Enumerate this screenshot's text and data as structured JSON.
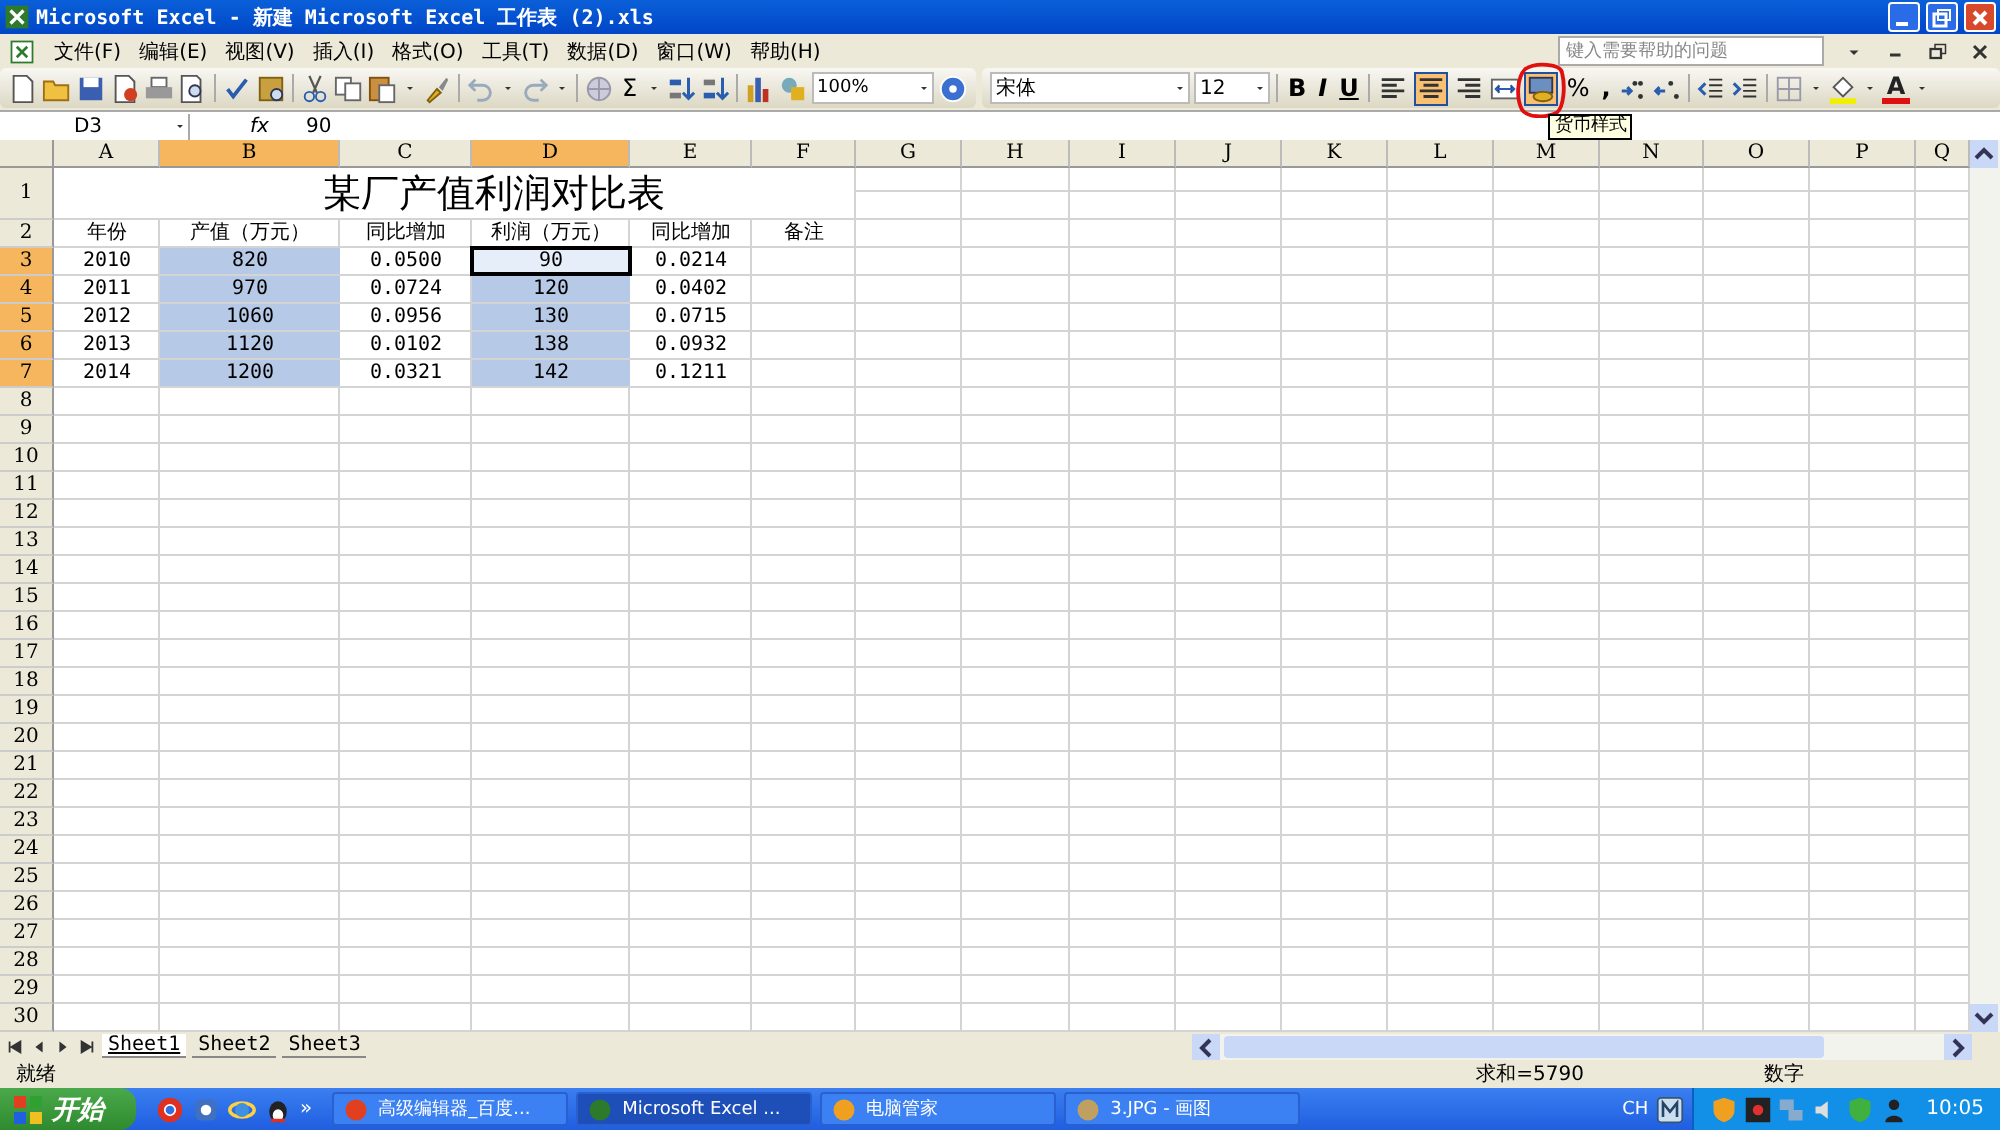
{
  "window": {
    "title": "Microsoft Excel - 新建 Microsoft Excel 工作表 (2).xls"
  },
  "menu": [
    "文件(F)",
    "编辑(E)",
    "视图(V)",
    "插入(I)",
    "格式(O)",
    "工具(T)",
    "数据(D)",
    "窗口(W)",
    "帮助(H)"
  ],
  "help_box": {
    "placeholder": "键入需要帮助的问题"
  },
  "toolbar": {
    "sum": "Σ",
    "zoom": "100%",
    "font": "宋体",
    "size": "12",
    "bold": "B",
    "italic": "I",
    "underline": "U",
    "alignment": [
      {
        "selected": false
      },
      {
        "selected": true
      },
      {
        "selected": false
      }
    ],
    "currency": {
      "pressed": true,
      "tooltip": "货币样式"
    },
    "percent": "%",
    "comma": ",",
    "font_color": "A"
  },
  "formula_bar": {
    "name_box": "D3",
    "fx": "fx",
    "value": "90"
  },
  "columns": [
    {
      "label": "A",
      "selected": false
    },
    {
      "label": "B",
      "selected": true
    },
    {
      "label": "C",
      "selected": false
    },
    {
      "label": "D",
      "selected": true
    },
    {
      "label": "E",
      "selected": false
    },
    {
      "label": "F",
      "selected": false
    },
    {
      "label": "G",
      "selected": false
    },
    {
      "label": "H",
      "selected": false
    },
    {
      "label": "I",
      "selected": false
    },
    {
      "label": "J",
      "selected": false
    },
    {
      "label": "K",
      "selected": false
    },
    {
      "label": "L",
      "selected": false
    },
    {
      "label": "M",
      "selected": false
    },
    {
      "label": "N",
      "selected": false
    },
    {
      "label": "O",
      "selected": false
    },
    {
      "label": "P",
      "selected": false
    },
    {
      "label": "Q",
      "selected": false
    }
  ],
  "rows": [
    {
      "number": "1",
      "selected": false,
      "title": "某厂产值利润对比表"
    },
    {
      "number": "2",
      "selected": false,
      "cells": [
        {
          "text": "年份",
          "selected": false,
          "active": false
        },
        {
          "text": "产值（万元）",
          "selected": false,
          "active": false
        },
        {
          "text": "同比增加",
          "selected": false,
          "active": false
        },
        {
          "text": "利润（万元）",
          "selected": false,
          "active": false
        },
        {
          "text": "同比增加",
          "selected": false,
          "active": false
        },
        {
          "text": "备注",
          "selected": false,
          "active": false
        }
      ]
    },
    {
      "number": "3",
      "selected": true,
      "cells": [
        {
          "text": "2010",
          "selected": false,
          "active": false
        },
        {
          "text": "820",
          "selected": true,
          "active": false
        },
        {
          "text": "0.0500",
          "selected": false,
          "active": false
        },
        {
          "text": "90",
          "selected": true,
          "active": true
        },
        {
          "text": "0.0214",
          "selected": false,
          "active": false
        }
      ]
    },
    {
      "number": "4",
      "selected": true,
      "cells": [
        {
          "text": "2011",
          "selected": false,
          "active": false
        },
        {
          "text": "970",
          "selected": true,
          "active": false
        },
        {
          "text": "0.0724",
          "selected": false,
          "active": false
        },
        {
          "text": "120",
          "selected": true,
          "active": false
        },
        {
          "text": "0.0402",
          "selected": false,
          "active": false
        }
      ]
    },
    {
      "number": "5",
      "selected": true,
      "cells": [
        {
          "text": "2012",
          "selected": false,
          "active": false
        },
        {
          "text": "1060",
          "selected": true,
          "active": false
        },
        {
          "text": "0.0956",
          "selected": false,
          "active": false
        },
        {
          "text": "130",
          "selected": true,
          "active": false
        },
        {
          "text": "0.0715",
          "selected": false,
          "active": false
        }
      ]
    },
    {
      "number": "6",
      "selected": true,
      "cells": [
        {
          "text": "2013",
          "selected": false,
          "active": false
        },
        {
          "text": "1120",
          "selected": true,
          "active": false
        },
        {
          "text": "0.0102",
          "selected": false,
          "active": false
        },
        {
          "text": "138",
          "selected": true,
          "active": false
        },
        {
          "text": "0.0932",
          "selected": false,
          "active": false
        }
      ]
    },
    {
      "number": "7",
      "selected": true,
      "cells": [
        {
          "text": "2014",
          "selected": false,
          "active": false
        },
        {
          "text": "1200",
          "selected": true,
          "active": false
        },
        {
          "text": "0.0321",
          "selected": false,
          "active": false
        },
        {
          "text": "142",
          "selected": true,
          "active": false
        },
        {
          "text": "0.1211",
          "selected": false,
          "active": false
        }
      ]
    },
    {
      "number": "8",
      "selected": false
    },
    {
      "number": "9",
      "selected": false
    },
    {
      "number": "10",
      "selected": false
    },
    {
      "number": "11",
      "selected": false
    },
    {
      "number": "12",
      "selected": false
    },
    {
      "number": "13",
      "selected": false
    },
    {
      "number": "14",
      "selected": false
    },
    {
      "number": "15",
      "selected": false
    },
    {
      "number": "16",
      "selected": false
    },
    {
      "number": "17",
      "selected": false
    },
    {
      "number": "18",
      "selected": false
    },
    {
      "number": "19",
      "selected": false
    },
    {
      "number": "20",
      "selected": false
    },
    {
      "number": "21",
      "selected": false
    },
    {
      "number": "22",
      "selected": false
    },
    {
      "number": "23",
      "selected": false
    },
    {
      "number": "24",
      "selected": false
    },
    {
      "number": "25",
      "selected": false
    },
    {
      "number": "26",
      "selected": false
    },
    {
      "number": "27",
      "selected": false
    },
    {
      "number": "28",
      "selected": false
    },
    {
      "number": "29",
      "selected": false
    },
    {
      "number": "30",
      "selected": false
    }
  ],
  "sheet_tabs": [
    {
      "label": "Sheet1",
      "selected": true
    },
    {
      "label": "Sheet2",
      "selected": false
    },
    {
      "label": "Sheet3",
      "selected": false
    }
  ],
  "status_bar": {
    "state": "就绪",
    "sum": "求和=5790",
    "mode": "数字"
  },
  "taskbar": {
    "start": "开始",
    "more": "»",
    "tasks": [
      {
        "label": "高级编辑器_百度...",
        "selected": false
      },
      {
        "label": "Microsoft Excel ...",
        "selected": true
      },
      {
        "label": "电脑管家",
        "selected": false
      },
      {
        "label": "3.JPG - 画图",
        "selected": false
      }
    ],
    "language": "CH",
    "clock": "10:05"
  }
}
